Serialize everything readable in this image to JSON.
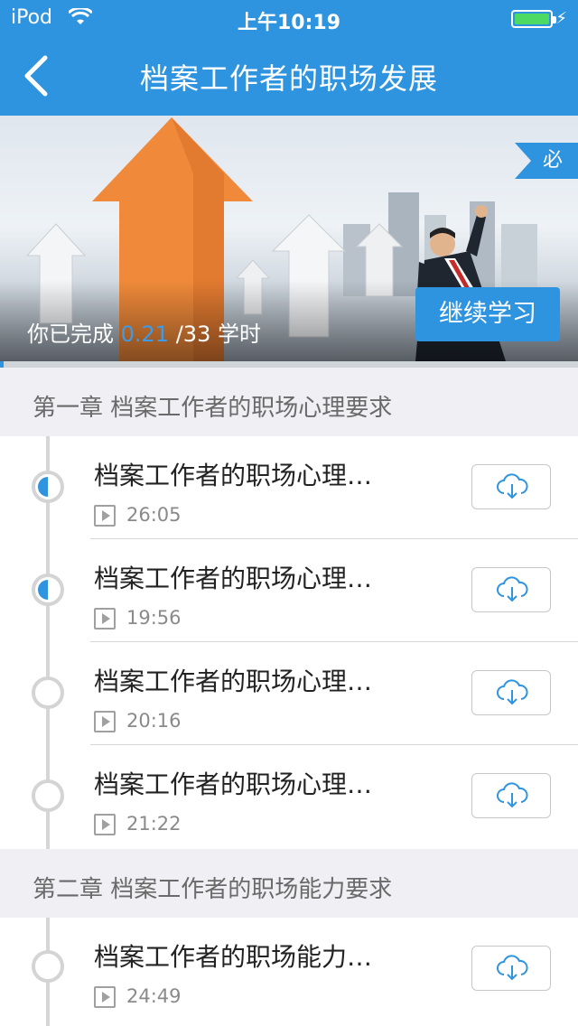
{
  "status_bar": {
    "carrier": "iPod",
    "time": "上午10:19"
  },
  "nav": {
    "title": "档案工作者的职场发展"
  },
  "hero": {
    "badge": "必",
    "progress_prefix": "你已完成",
    "progress_value": "0.21",
    "progress_total": "/33 学时",
    "progress_fraction": 0.0064,
    "continue_label": "继续学习"
  },
  "chapters": [
    {
      "title": "第一章 档案工作者的职场心理要求",
      "items": [
        {
          "title": "档案工作者的职场心理…",
          "duration": "26:05",
          "state": "half"
        },
        {
          "title": "档案工作者的职场心理…",
          "duration": "19:56",
          "state": "half"
        },
        {
          "title": "档案工作者的职场心理…",
          "duration": "20:16",
          "state": "empty"
        },
        {
          "title": "档案工作者的职场心理…",
          "duration": "21:22",
          "state": "empty"
        }
      ]
    },
    {
      "title": "第二章 档案工作者的职场能力要求",
      "items": [
        {
          "title": "档案工作者的职场能力…",
          "duration": "24:49",
          "state": "empty"
        }
      ]
    }
  ],
  "colors": {
    "accent": "#2f94e0",
    "section_bg": "#efeff4"
  }
}
